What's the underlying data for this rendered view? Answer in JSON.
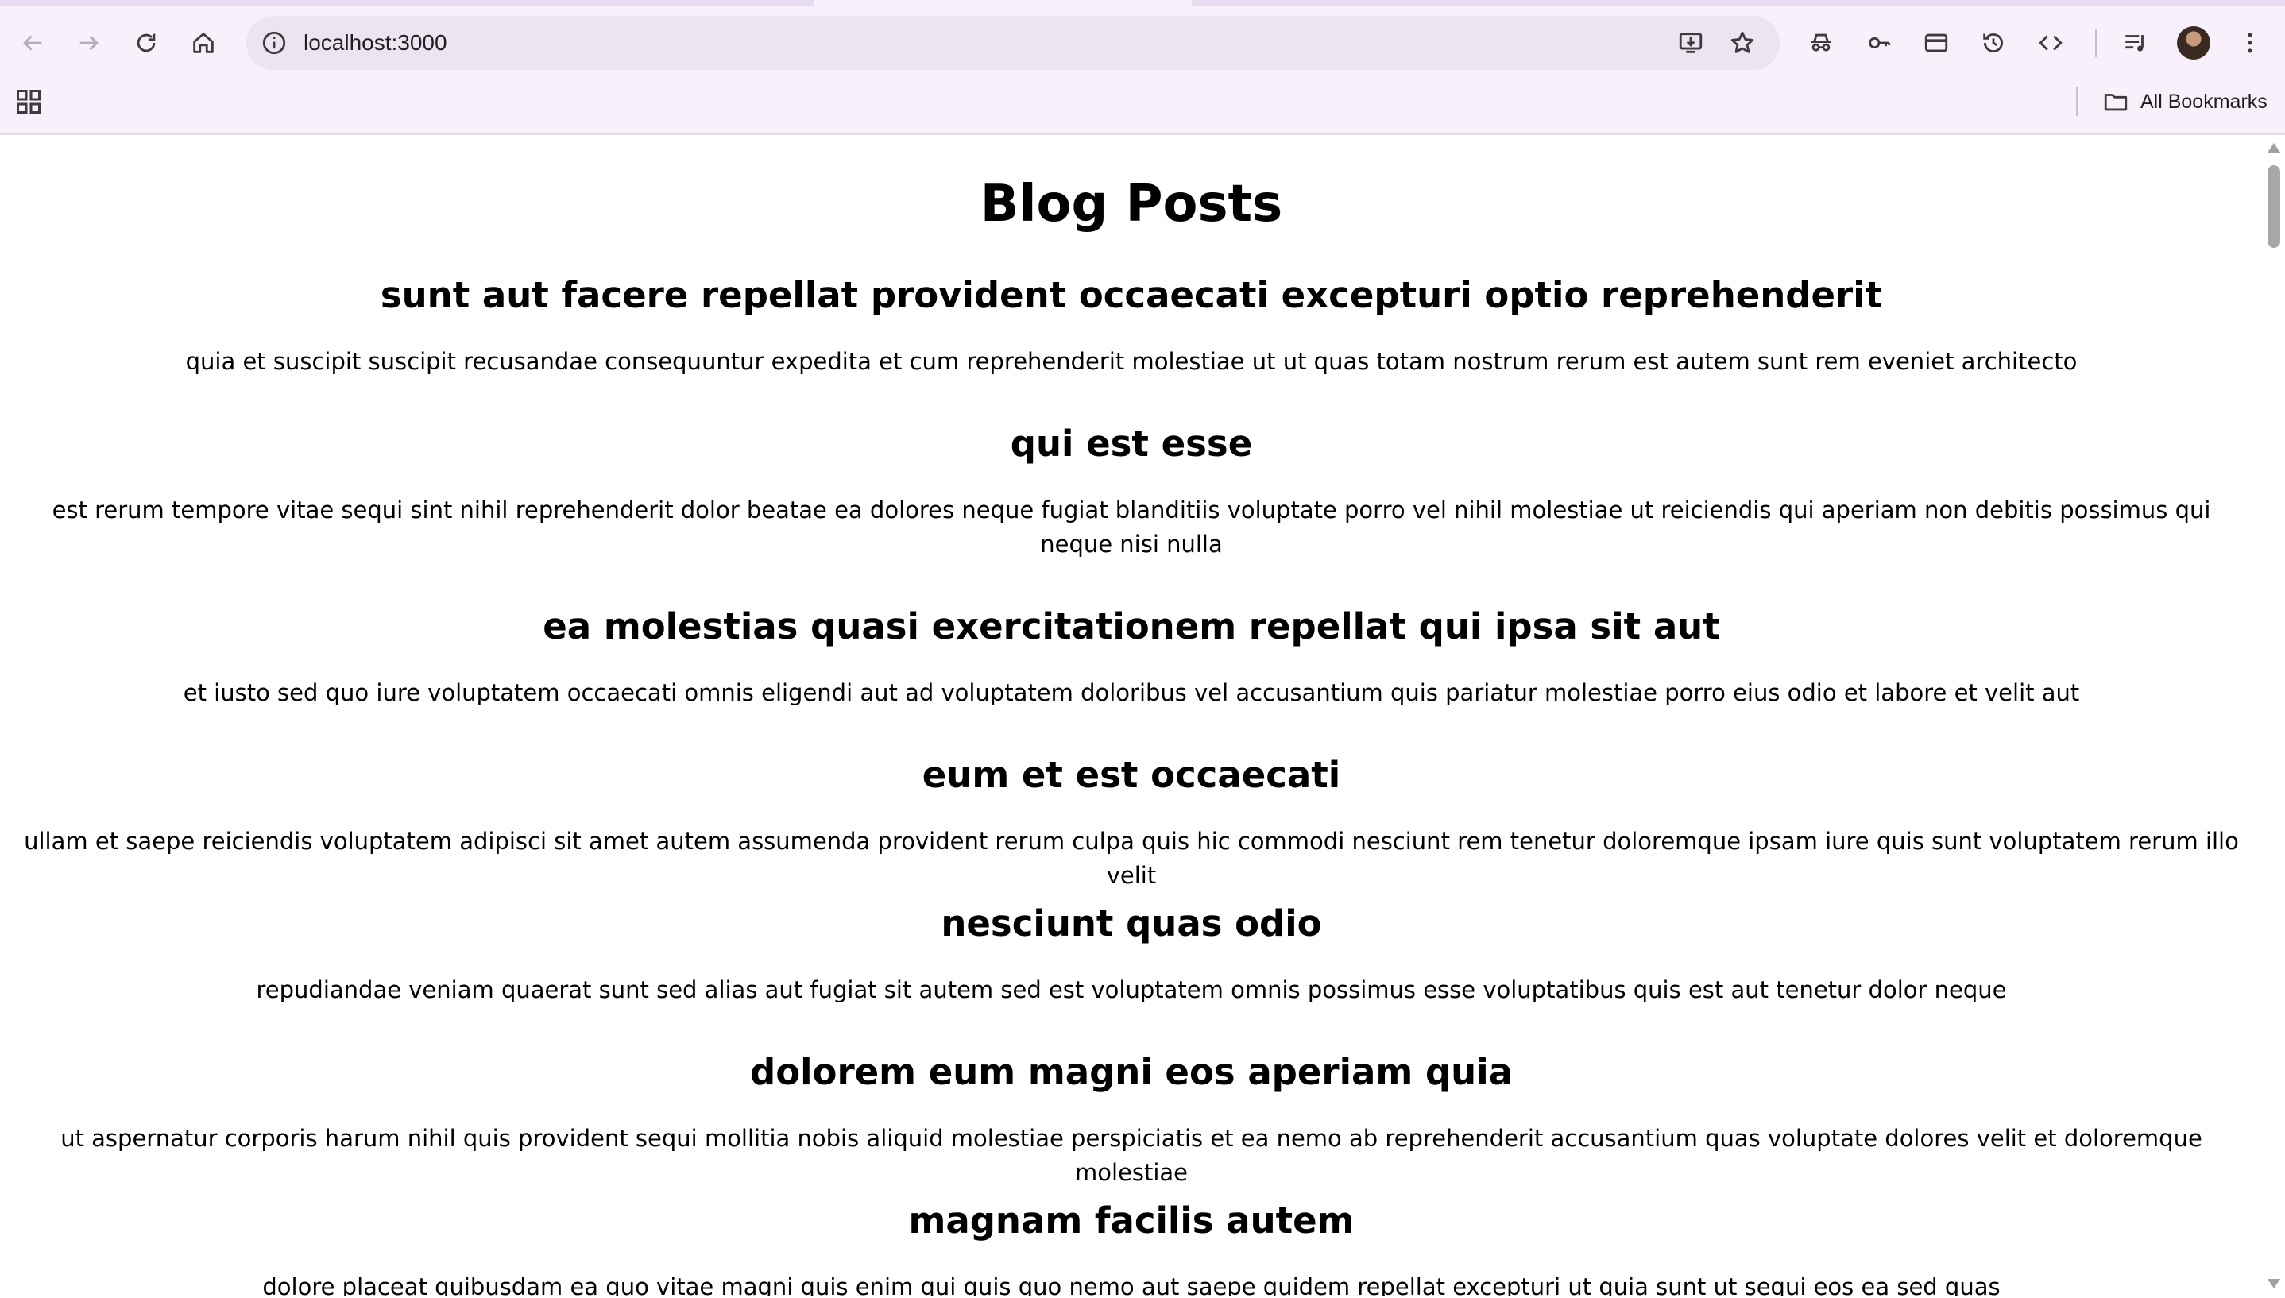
{
  "browser": {
    "address": "localhost:3000",
    "bookmarks_label": "All Bookmarks",
    "toolbar_icons": [
      "back-icon",
      "forward-icon",
      "reload-icon",
      "home-icon",
      "site-info-icon",
      "install-app-icon",
      "star-icon",
      "incognito-icon",
      "passwords-icon",
      "payment-card-icon",
      "history-icon",
      "code-icon",
      "media-queue-icon",
      "avatar",
      "more-menu-icon",
      "apps-grid-icon",
      "folder-icon"
    ],
    "accent": "#f8f1fb"
  },
  "page": {
    "title": "Blog Posts",
    "posts": [
      {
        "title": "sunt aut facere repellat provident occaecati excepturi optio reprehenderit",
        "body": "quia et suscipit suscipit recusandae consequuntur expedita et cum reprehenderit molestiae ut ut quas totam nostrum rerum est autem sunt rem eveniet architecto"
      },
      {
        "title": "qui est esse",
        "body": "est rerum tempore vitae sequi sint nihil reprehenderit dolor beatae ea dolores neque fugiat blanditiis voluptate porro vel nihil molestiae ut reiciendis qui aperiam non debitis possimus qui neque nisi nulla"
      },
      {
        "title": "ea molestias quasi exercitationem repellat qui ipsa sit aut",
        "body": "et iusto sed quo iure voluptatem occaecati omnis eligendi aut ad voluptatem doloribus vel accusantium quis pariatur molestiae porro eius odio et labore et velit aut"
      },
      {
        "title": "eum et est occaecati",
        "body": "ullam et saepe reiciendis voluptatem adipisci sit amet autem assumenda provident rerum culpa quis hic commodi nesciunt rem tenetur doloremque ipsam iure quis sunt voluptatem rerum illo velit"
      },
      {
        "title": "nesciunt quas odio",
        "body": "repudiandae veniam quaerat sunt sed alias aut fugiat sit autem sed est voluptatem omnis possimus esse voluptatibus quis est aut tenetur dolor neque"
      },
      {
        "title": "dolorem eum magni eos aperiam quia",
        "body": "ut aspernatur corporis harum nihil quis provident sequi mollitia nobis aliquid molestiae perspiciatis et ea nemo ab reprehenderit accusantium quas voluptate dolores velit et doloremque molestiae"
      },
      {
        "title": "magnam facilis autem",
        "body": "dolore placeat quibusdam ea quo vitae magni quis enim qui quis quo nemo aut saepe quidem repellat excepturi ut quia sunt ut sequi eos ea sed quas"
      }
    ]
  }
}
